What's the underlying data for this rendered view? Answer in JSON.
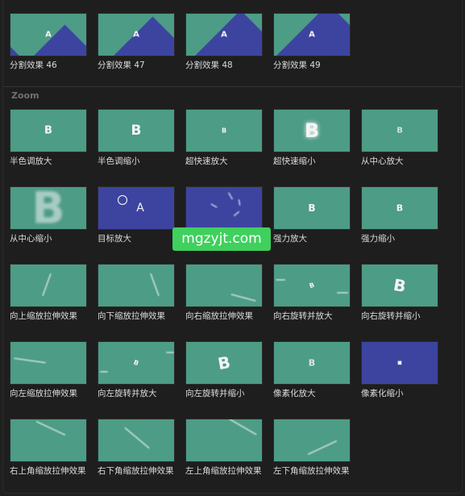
{
  "top_row": [
    {
      "label": "分割效果 46",
      "glyph": "A"
    },
    {
      "label": "分割效果 47",
      "glyph": "A"
    },
    {
      "label": "分割效果 48",
      "glyph": "A"
    },
    {
      "label": "分割效果 49",
      "glyph": "A"
    }
  ],
  "section_title": "Zoom",
  "zoom_items": [
    {
      "label": "半色调放大",
      "glyph": "B"
    },
    {
      "label": "半色调缩小",
      "glyph": "B"
    },
    {
      "label": "超快速放大",
      "glyph": "B"
    },
    {
      "label": "超快速缩小",
      "glyph": "B"
    },
    {
      "label": "从中心放大",
      "glyph": "B"
    },
    {
      "label": "从中心缩小",
      "glyph": "B"
    },
    {
      "label": "目标放大",
      "glyph": "A"
    },
    {
      "label": "",
      "glyph": ""
    },
    {
      "label": "强力放大",
      "glyph": "B"
    },
    {
      "label": "强力缩小",
      "glyph": "B"
    },
    {
      "label": "向上缩放拉伸效果",
      "glyph": ""
    },
    {
      "label": "向下缩放拉伸效果",
      "glyph": ""
    },
    {
      "label": "向右缩放拉伸效果",
      "glyph": ""
    },
    {
      "label": "向右旋转并放大",
      "glyph": "B"
    },
    {
      "label": "向右旋转并缩小",
      "glyph": "B"
    },
    {
      "label": "向左缩放拉伸效果",
      "glyph": ""
    },
    {
      "label": "向左旋转并放大",
      "glyph": "B"
    },
    {
      "label": "向左旋转并缩小",
      "glyph": "B"
    },
    {
      "label": "像素化放大",
      "glyph": "B"
    },
    {
      "label": "像素化缩小",
      "glyph": "■"
    },
    {
      "label": "右上角缩放拉伸效果",
      "glyph": ""
    },
    {
      "label": "右下角缩放拉伸效果",
      "glyph": ""
    },
    {
      "label": "左上角缩放拉伸效果",
      "glyph": ""
    },
    {
      "label": "左下角缩放拉伸效果",
      "glyph": ""
    }
  ],
  "watermark": "mgzyjt.com",
  "colors": {
    "teal": "#4d9c86",
    "blue": "#3d44a0",
    "background": "#1e1e1e"
  }
}
